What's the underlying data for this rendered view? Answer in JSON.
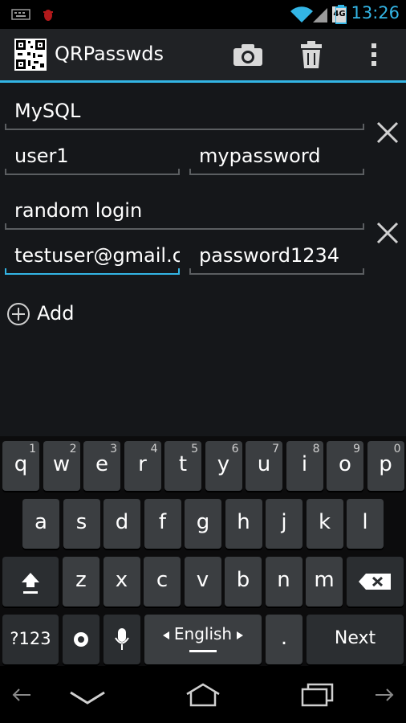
{
  "status_bar": {
    "time": "13:26",
    "network": "4G"
  },
  "app": {
    "title": "QRPasswds"
  },
  "entries": [
    {
      "title": "MySQL",
      "username": "user1",
      "password": "mypassword"
    },
    {
      "title": "random login",
      "username": "testuser@gmail.c",
      "password": "password1234"
    }
  ],
  "add_label": "Add",
  "keyboard": {
    "row1": [
      {
        "k": "q",
        "h": "1"
      },
      {
        "k": "w",
        "h": "2"
      },
      {
        "k": "e",
        "h": "3"
      },
      {
        "k": "r",
        "h": "4"
      },
      {
        "k": "t",
        "h": "5"
      },
      {
        "k": "y",
        "h": "6"
      },
      {
        "k": "u",
        "h": "7"
      },
      {
        "k": "i",
        "h": "8"
      },
      {
        "k": "o",
        "h": "9"
      },
      {
        "k": "p",
        "h": "0"
      }
    ],
    "row2": [
      "a",
      "s",
      "d",
      "f",
      "g",
      "h",
      "j",
      "k",
      "l"
    ],
    "row3": [
      "z",
      "x",
      "c",
      "v",
      "b",
      "n",
      "m"
    ],
    "symbols_label": "?123",
    "language_label": "English",
    "period_label": ".",
    "next_label": "Next"
  },
  "colors": {
    "accent": "#33b5e5",
    "background": "#15171a",
    "key": "#3b3e41"
  }
}
